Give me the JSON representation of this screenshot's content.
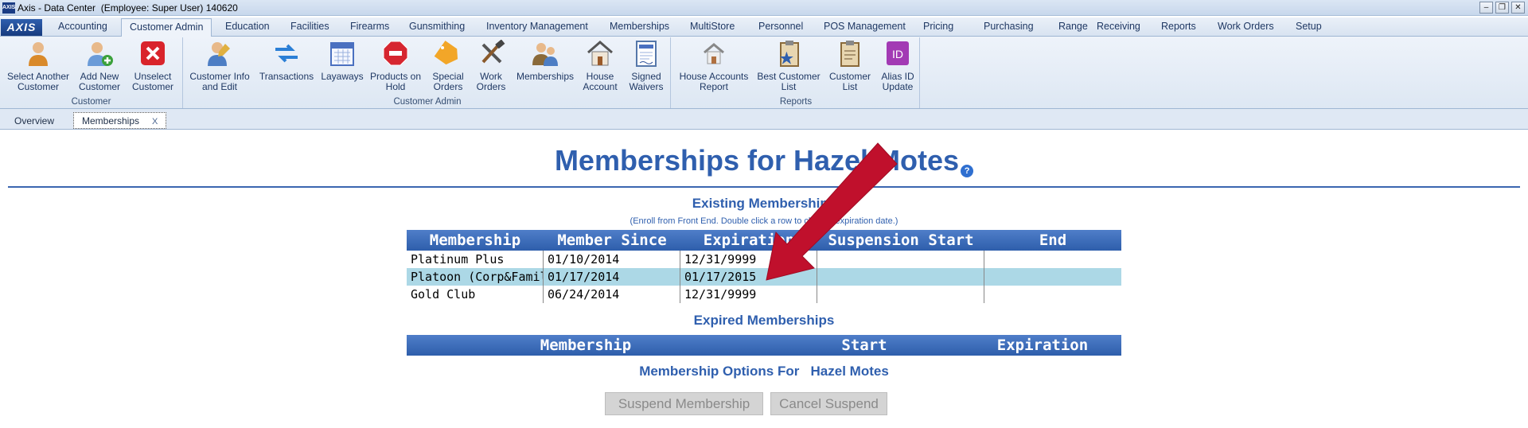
{
  "window": {
    "title": "Axis - Data Center  (Employee: Super User) 140620",
    "logo": "AXIS",
    "controls": [
      "minimize-icon",
      "restore-icon",
      "close-icon"
    ]
  },
  "menubar": {
    "logo": "AXIS",
    "tabs": [
      "Accounting",
      "Customer Admin",
      "Education",
      "Facilities",
      "Firearms",
      "Gunsmithing",
      "Inventory Management",
      "Memberships",
      "MultiStore",
      "Personnel",
      "POS Management",
      "Pricing",
      "Purchasing",
      "Range",
      "Receiving",
      "Reports",
      "Work Orders",
      "Setup"
    ],
    "active": "Customer Admin"
  },
  "ribbon": {
    "groups": [
      {
        "label": "Customer",
        "buttons": [
          {
            "l1": "Select Another",
            "l2": "Customer",
            "icon": "person-icon"
          },
          {
            "l1": "Add New",
            "l2": "Customer",
            "icon": "add-person-icon"
          },
          {
            "l1": "Unselect",
            "l2": "Customer",
            "icon": "red-x-icon"
          }
        ]
      },
      {
        "label": "Customer Admin",
        "buttons": [
          {
            "l1": "Customer Info",
            "l2": "and Edit",
            "icon": "person-edit-icon"
          },
          {
            "l1": "Transactions",
            "l2": "",
            "icon": "transfer-arrows-icon"
          },
          {
            "l1": "Layaways",
            "l2": "",
            "icon": "calendar-icon"
          },
          {
            "l1": "Products on",
            "l2": "Hold",
            "icon": "stop-sign-icon"
          },
          {
            "l1": "Special",
            "l2": "Orders",
            "icon": "special-tag-icon"
          },
          {
            "l1": "Work",
            "l2": "Orders",
            "icon": "tools-icon"
          },
          {
            "l1": "Memberships",
            "l2": "",
            "icon": "members-icon"
          },
          {
            "l1": "House",
            "l2": "Account",
            "icon": "house-icon"
          },
          {
            "l1": "Signed",
            "l2": "Waivers",
            "icon": "waiver-document-icon"
          }
        ]
      },
      {
        "label": "Reports",
        "buttons": [
          {
            "l1": "House Accounts",
            "l2": "Report",
            "icon": "house-report-icon"
          },
          {
            "l1": "Best Customer",
            "l2": "List",
            "icon": "star-clipboard-icon"
          },
          {
            "l1": "Customer",
            "l2": "List",
            "icon": "clipboard-icon"
          },
          {
            "l1": "Alias ID",
            "l2": "Update",
            "icon": "id-badge-icon"
          }
        ]
      }
    ]
  },
  "doctabs": {
    "overview": "Overview",
    "memberships": "Memberships",
    "close": "X"
  },
  "page": {
    "title": "Memberships for Hazel Motes",
    "help": "?",
    "existing": {
      "heading": "Existing Memberships",
      "note": "(Enroll from Front End. Double click a row to change expiration date.)",
      "columns": [
        "Membership",
        "Member Since",
        "Expiration",
        "Suspension Start",
        "End"
      ],
      "rows": [
        [
          "Platinum Plus",
          "01/10/2014",
          "12/31/9999",
          "",
          ""
        ],
        [
          "Platoon (Corp&Family)",
          "01/17/2014",
          "01/17/2015",
          "",
          ""
        ],
        [
          "Gold Club",
          "06/24/2014",
          "12/31/9999",
          "",
          ""
        ]
      ],
      "selected_row": 1
    },
    "expired": {
      "heading": "Expired Memberships",
      "columns": [
        "Membership",
        "Start",
        "Expiration"
      ]
    },
    "options": {
      "heading": "Membership Options For   Hazel Motes",
      "suspend": "Suspend Membership",
      "cancel": "Cancel Suspend"
    }
  },
  "colors": {
    "accent": "#2f5fae",
    "header_blue": "#3b6cbc",
    "selected_row": "#acd8e6",
    "arrow": "#c0102c"
  }
}
